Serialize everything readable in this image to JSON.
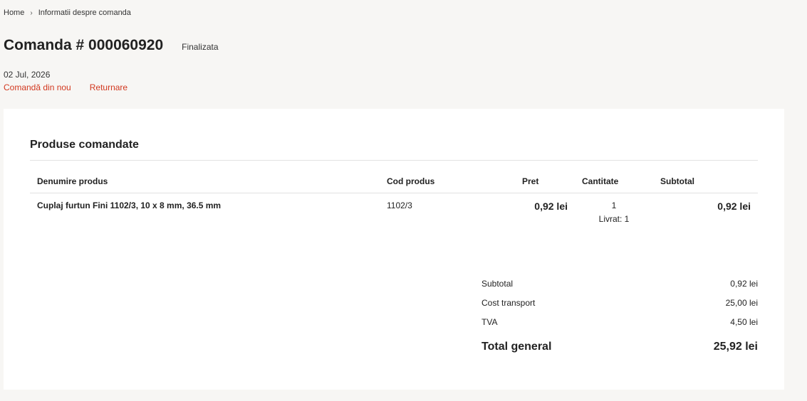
{
  "breadcrumb": {
    "home": "Home",
    "separator": "›",
    "current": "Informatii despre comanda"
  },
  "order": {
    "title": "Comanda # 000060920",
    "status": "Finalizata",
    "date": "02 Jul, 2026",
    "reorder_label": "Comandă din nou",
    "return_label": "Returnare"
  },
  "products": {
    "section_title": "Produse comandate",
    "headers": {
      "name": "Denumire produs",
      "code": "Cod produs",
      "price": "Pret",
      "qty": "Cantitate",
      "subtotal": "Subtotal"
    },
    "items": [
      {
        "name": "Cuplaj furtun Fini 1102/3, 10 x 8 mm, 36.5 mm",
        "code": "1102/3",
        "price": "0,92 lei",
        "qty": "1",
        "delivered": "Livrat: 1",
        "subtotal": "0,92 lei"
      }
    ]
  },
  "totals": {
    "subtotal_label": "Subtotal",
    "subtotal_value": "0,92 lei",
    "shipping_label": "Cost transport",
    "shipping_value": "25,00 lei",
    "vat_label": "TVA",
    "vat_value": "4,50 lei",
    "grand_label": "Total general",
    "grand_value": "25,92 lei"
  },
  "colors": {
    "accent": "#d2381f",
    "background": "#f7f6f4",
    "card": "#ffffff"
  }
}
